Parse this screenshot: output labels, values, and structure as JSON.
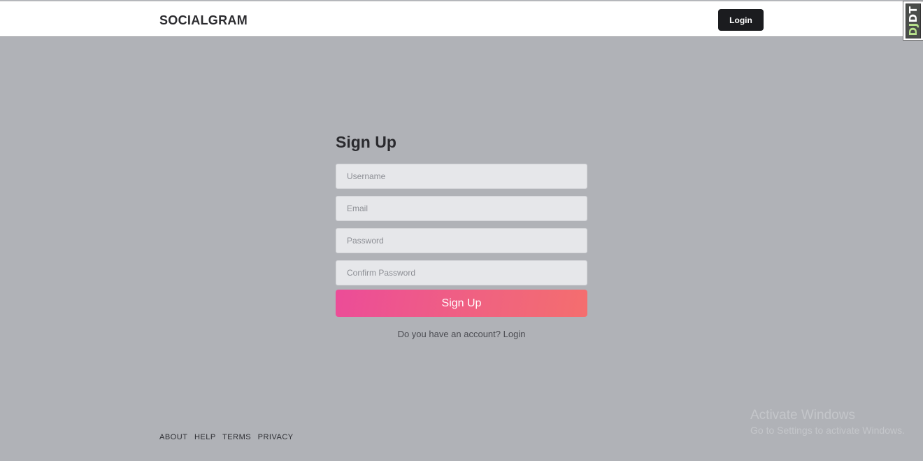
{
  "header": {
    "brand": "SOCIALGRAM",
    "login_label": "Login"
  },
  "debug_toolbar": {
    "label_dj": "DJ",
    "label_dt": "DT"
  },
  "signup": {
    "title": "Sign Up",
    "username_placeholder": "Username",
    "email_placeholder": "Email",
    "password_placeholder": "Password",
    "confirm_placeholder": "Confirm Password",
    "submit_label": "Sign Up",
    "account_prompt": "Do you have an account?",
    "login_link": "Login"
  },
  "footer": {
    "links": [
      "ABOUT",
      "HELP",
      "TERMS",
      "PRIVACY"
    ]
  },
  "watermark": {
    "title": "Activate Windows",
    "subtitle": "Go to Settings to activate Windows."
  },
  "colors": {
    "page_bg": "#b0b2b7",
    "header_bg": "#ffffff",
    "primary_dark": "#1b1c1f",
    "gradient_start": "#ec4c98",
    "gradient_end": "#f46e6e"
  }
}
